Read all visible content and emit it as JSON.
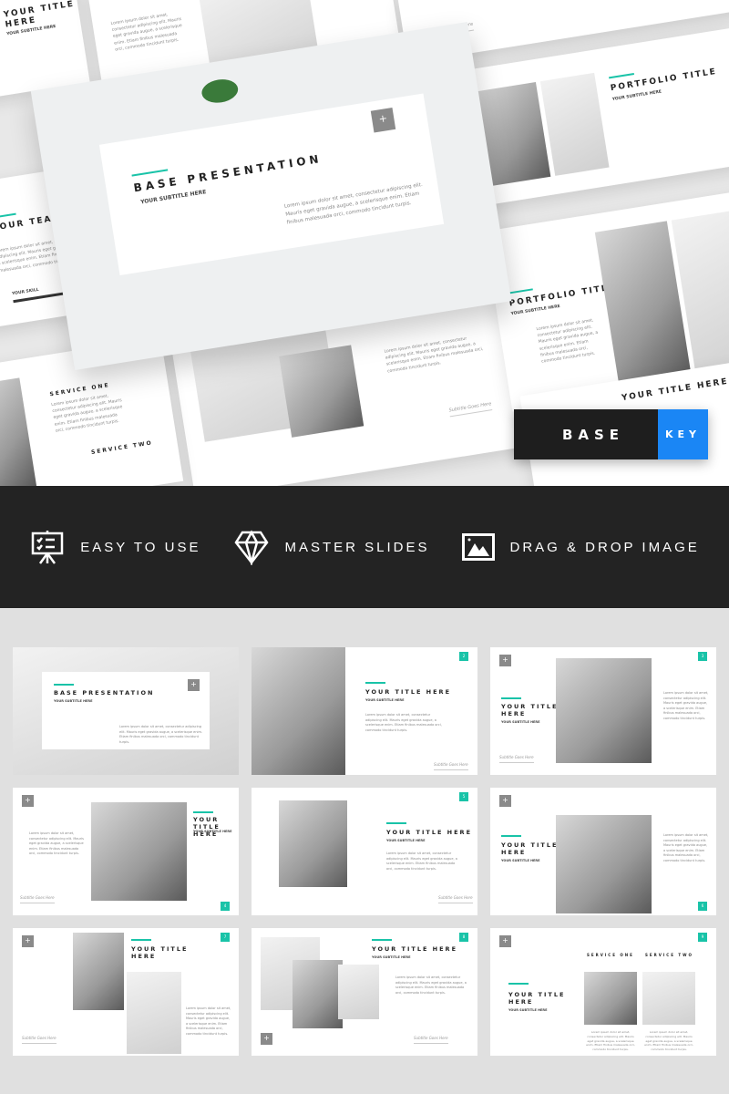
{
  "hero": {
    "main_title": "BASE PRESENTATION",
    "main_subtitle": "YOUR SUBTITLE HERE",
    "lorem": "Lorem ipsum dolor sit amet, consectetur adipiscing elit. Mauris eget gravida augue, a scelerisque enim. Etiam finibus malesuada orci, commodo tincidunt turpis.",
    "your_title": "YOUR TITLE\nHERE",
    "your_title_here": "YOUR TITLE HERE",
    "portfolio_title": "PORTFOLIO TITLE",
    "team_name": "YOUR TEAM NAME",
    "skill": "YOUR SKILL",
    "service_one": "SERVICE ONE",
    "service_two": "SERVICE TWO",
    "signature": "Subtitle Goes Here",
    "subtitle": "YOUR SUBTITLE HERE"
  },
  "badge": {
    "left": "BASE",
    "right": "KEY",
    "left_color": "#1e1e1e",
    "right_color": "#1a86f5"
  },
  "features": [
    {
      "label": "EASY TO USE",
      "icon": "presentation-board-icon"
    },
    {
      "label": "MASTER SLIDES",
      "icon": "diamond-icon"
    },
    {
      "label": "DRAG & DROP IMAGE",
      "icon": "image-icon"
    }
  ],
  "accent_color": "#19c3a8",
  "slides": [
    {
      "title": "BASE PRESENTATION",
      "subtitle": "YOUR SUBTITLE HERE",
      "number": ""
    },
    {
      "title": "YOUR TITLE HERE",
      "subtitle": "YOUR SUBTITLE HERE",
      "number": "2",
      "signature": "Subtitle Goes Here"
    },
    {
      "title": "YOUR TITLE\nHERE",
      "subtitle": "YOUR SUBTITLE HERE",
      "number": "3",
      "signature": "Subtitle Goes Here"
    },
    {
      "title": "YOUR TITLE\nHERE",
      "subtitle": "YOUR SUBTITLE HERE",
      "number": "4",
      "signature": "Subtitle Goes Here"
    },
    {
      "title": "YOUR TITLE HERE",
      "subtitle": "YOUR SUBTITLE HERE",
      "number": "5",
      "signature": "Subtitle Goes Here"
    },
    {
      "title": "YOUR TITLE\nHERE",
      "subtitle": "YOUR SUBTITLE HERE",
      "number": "6",
      "signature": "Subtitle Goes Here"
    },
    {
      "title": "YOUR TITLE\nHERE",
      "subtitle": "YOUR SUBTITLE HERE",
      "number": "7",
      "signature": "Subtitle Goes Here"
    },
    {
      "title": "YOUR TITLE HERE",
      "subtitle": "YOUR SUBTITLE HERE",
      "number": "8",
      "signature": "Subtitle Goes Here"
    },
    {
      "title": "YOUR TITLE\nHERE",
      "subtitle": "YOUR SUBTITLE HERE",
      "number": "9",
      "service_one": "SERVICE ONE",
      "service_two": "SERVICE TWO"
    }
  ]
}
